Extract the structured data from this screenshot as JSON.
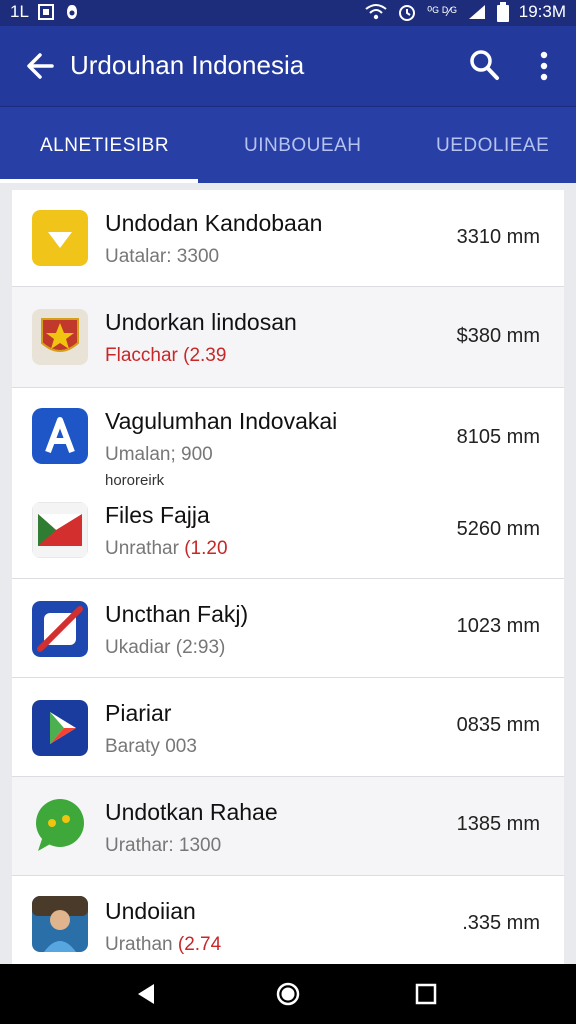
{
  "status": {
    "left_text": "1L",
    "time": "19:3M",
    "signal_text": "⁰ᴳ ᴰ⁄ᴳ"
  },
  "app_bar": {
    "title": "Urdouhan Indonesia",
    "back_icon": "arrow-left-icon",
    "search_icon": "search-icon",
    "more_icon": "more-vert-icon"
  },
  "tabs": [
    {
      "label": "ALNETIESIBR",
      "active": true
    },
    {
      "label": "UINBOUEAH",
      "active": false
    },
    {
      "label": "UEDOLIEAE",
      "active": false
    }
  ],
  "apps": [
    {
      "name": "Undodan Kandobaan",
      "sub_prefix": "Uatalar: 3300",
      "sub_highlight": "",
      "size": "3310 mm",
      "icon": "yellow-download-icon",
      "icon_color": "#f0c419"
    },
    {
      "name": "Undorkan lindosan",
      "sub_prefix": "",
      "sub_highlight": "Flacchar (2.39",
      "size": "$380 mm",
      "icon": "emblem-icon",
      "icon_color": "#c0392b"
    },
    {
      "name": "Vagulumhan Indovakai",
      "sub_prefix": "Umalan; 900",
      "sub_highlight": "",
      "size": "8105 mm",
      "icon": "letter-a-icon",
      "icon_color": "#1e56c8",
      "extra": "hororeirk"
    },
    {
      "name": "Files Fajja",
      "sub_prefix": "Unrathar ",
      "sub_highlight": "(1.20",
      "size": "5260 mm",
      "icon": "flag-icon",
      "icon_color": "#d32f2f"
    },
    {
      "name": "Uncthan Fakj)",
      "sub_prefix": "Ukadiar (2:93)",
      "sub_highlight": "",
      "size": "1023 mm",
      "icon": "blocked-icon",
      "icon_color": "#1e48b0"
    },
    {
      "name": "Piariar",
      "sub_prefix": "Baraty 003",
      "sub_highlight": "",
      "size": "0835 mm",
      "icon": "play-icon",
      "icon_color": "#1a3c9e"
    },
    {
      "name": "Undotkan Rahae",
      "sub_prefix": "Urathar: 1300",
      "sub_highlight": "",
      "size": "1385 mm",
      "icon": "chat-bubble-icon",
      "icon_color": "#3fa83a"
    },
    {
      "name": "Undoiian",
      "sub_prefix": "Urathan ",
      "sub_highlight": "(2.74",
      "size": ".335 mm",
      "icon": "photo-avatar-icon",
      "icon_color": "#2b6fa8"
    }
  ],
  "nav": {
    "back_icon": "nav-back-icon",
    "home_icon": "nav-home-icon",
    "recents_icon": "nav-recents-icon"
  }
}
